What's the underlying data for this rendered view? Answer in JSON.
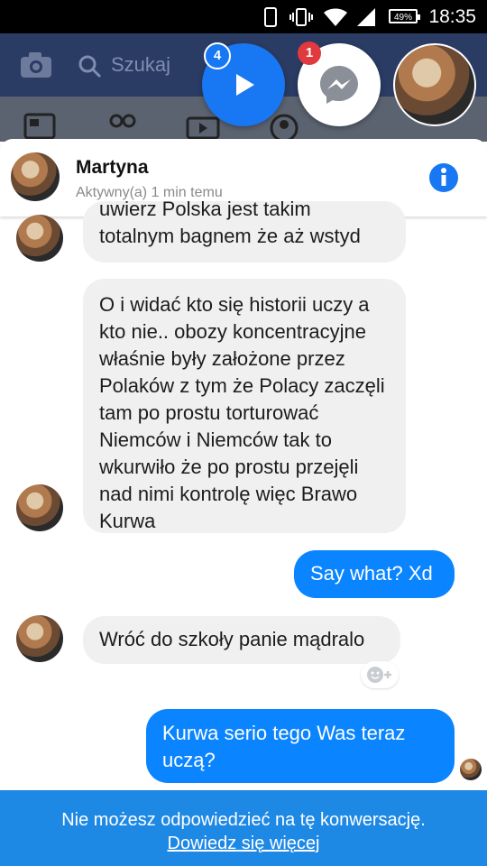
{
  "statusbar": {
    "battery": "49%",
    "time": "18:35"
  },
  "fb": {
    "search_placeholder": "Szukaj"
  },
  "floating": {
    "video_badge": "4",
    "messenger_badge": "1"
  },
  "chat": {
    "name": "Martyna",
    "status": "Aktywny(a) 1 min temu"
  },
  "messages": [
    {
      "dir": "in",
      "text": "uwierz Polska jest takim totalnym bagnem że aż wstyd"
    },
    {
      "dir": "in",
      "text": "O i widać kto się historii  uczy a kto nie.. obozy koncentracyjne właśnie były założone przez Polaków z tym że Polacy zaczęli tam po prostu torturować Niemców i Niemców tak to wkurwiło że po prostu przejęli nad nimi kontrolę więc Brawo Kurwa"
    },
    {
      "dir": "out",
      "text": "Say what? Xd"
    },
    {
      "dir": "in",
      "text": "Wróć do szkoły panie mądralo"
    },
    {
      "dir": "out",
      "text": "Kurwa serio tego Was teraz uczą?"
    }
  ],
  "footer": {
    "notice": "Nie możesz odpowiedzieć na tę konwersację.",
    "link": "Dowiedz się więcej"
  },
  "colors": {
    "messenger_blue": "#0a84ff",
    "fb_navy": "#2a3b64",
    "footer_blue": "#1e88e5"
  },
  "icons": [
    "camera-icon",
    "search-icon",
    "play-icon",
    "messenger-icon",
    "info-icon",
    "emoji-add-icon"
  ]
}
